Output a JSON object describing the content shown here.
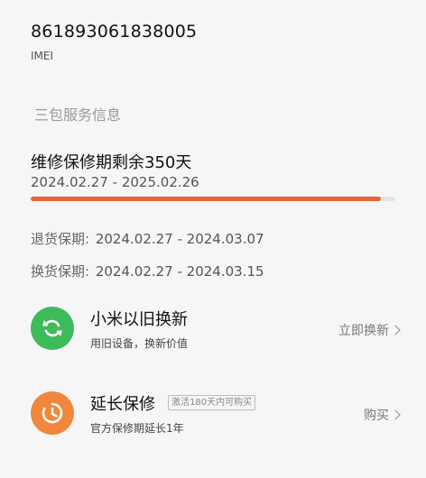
{
  "device": {
    "imei_value": "861893061838005",
    "imei_label": "IMEI"
  },
  "section": {
    "title": "三包服务信息"
  },
  "warranty": {
    "title": "维修保修期剩余350天",
    "range": "2024.02.27 - 2025.02.26",
    "remaining_fraction": 0.96,
    "accent_color": "#e8643a"
  },
  "periods": {
    "return": {
      "label": "退货保期:",
      "value": "2024.02.27 - 2024.03.07"
    },
    "exchange": {
      "label": "换货保期:",
      "value": "2024.02.27 - 2024.03.15"
    }
  },
  "services": [
    {
      "title": "小米以旧换新",
      "description": "用旧设备，换新价值",
      "action": "立即换新",
      "icon": "refresh-icon",
      "color": "#3dbb5a"
    },
    {
      "title": "延长保修",
      "badge": "激活180天内可购买",
      "description": "官方保修期延长1年",
      "action": "购买",
      "icon": "clock-icon",
      "color": "#f0873c"
    }
  ]
}
